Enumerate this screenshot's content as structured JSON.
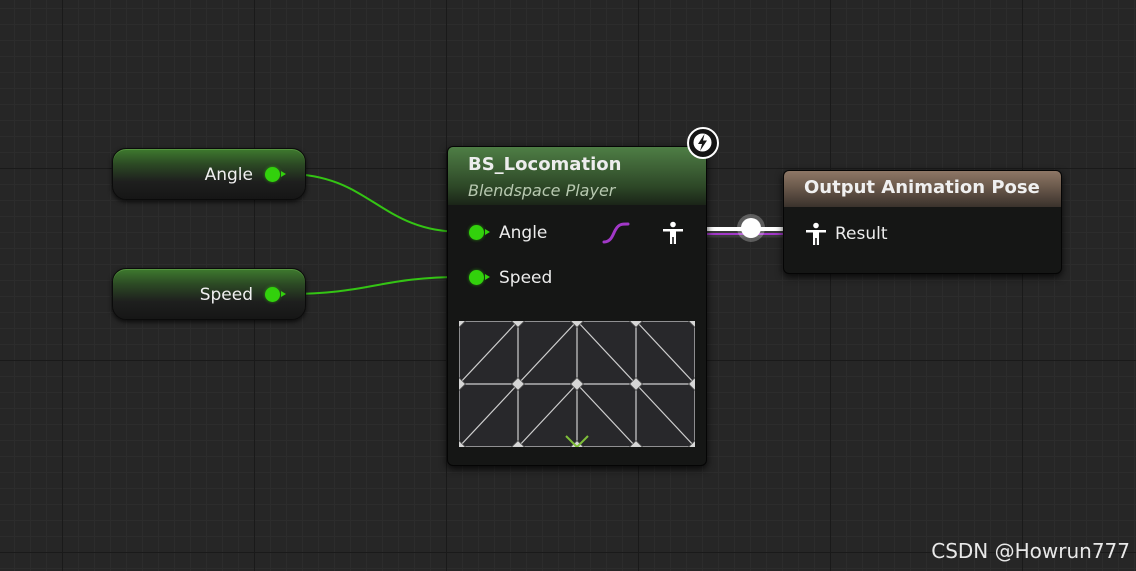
{
  "variables": [
    {
      "label": "Angle"
    },
    {
      "label": "Speed"
    }
  ],
  "blendspace_node": {
    "title": "BS_Locomation",
    "subtitle": "Blendspace Player",
    "inputs": [
      "Angle",
      "Speed"
    ],
    "badge_icon": "lightning-icon",
    "curve_icon": "curve-icon",
    "pose_icon": "pose-icon"
  },
  "output_node": {
    "title": "Output Animation Pose",
    "input_label": "Result",
    "pose_icon": "pose-icon"
  },
  "colors": {
    "float_pin": "#32d10c",
    "pose_wire": "#ffffff",
    "curve": "#a238c8",
    "blendspace_header": "#4e7e45",
    "output_header": "#8e7766"
  },
  "watermark": "CSDN @Howrun777"
}
